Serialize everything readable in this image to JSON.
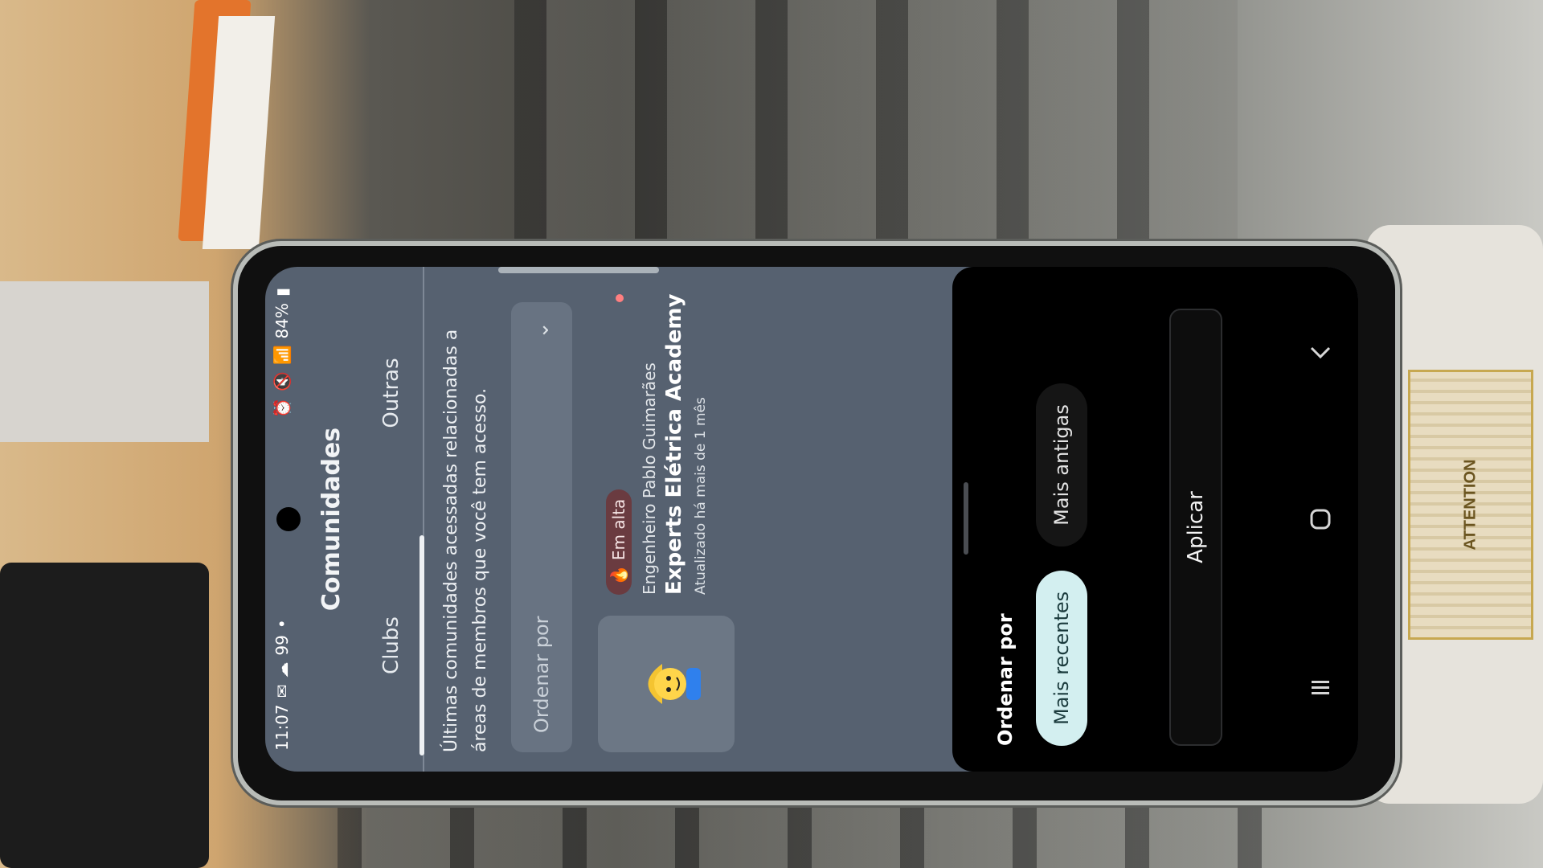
{
  "status_bar": {
    "time": "11:07",
    "battery": "84%",
    "left_icons": [
      "gmail-icon",
      "cloud-icon",
      "badge-99"
    ],
    "left_text": "99"
  },
  "app": {
    "title": "Comunidades",
    "tabs": [
      {
        "label": "Clubs",
        "active": true
      },
      {
        "label": "Outras",
        "active": false
      }
    ],
    "description": "Últimas comunidades acessadas relacionadas a áreas de membros que você tem acesso.",
    "sort_placeholder": "Ordenar por",
    "community": {
      "badge": "Em alta",
      "author": "Engenheiro Pablo Guimarães",
      "name": "Experts Elétrica Academy",
      "updated": "Atualizado há mais de 1 mês"
    }
  },
  "sheet": {
    "heading": "Ordenar por",
    "options": [
      {
        "label": "Mais recentes",
        "selected": true
      },
      {
        "label": "Mais antigas",
        "selected": false
      }
    ],
    "apply_label": "Aplicar"
  },
  "background": {
    "label_text": "ATTENTION"
  },
  "colors": {
    "app_bg": "#566170",
    "chip_selected": "#d3eff0",
    "sheet_bg": "#000000",
    "badge_bg": "#6a3b40"
  }
}
